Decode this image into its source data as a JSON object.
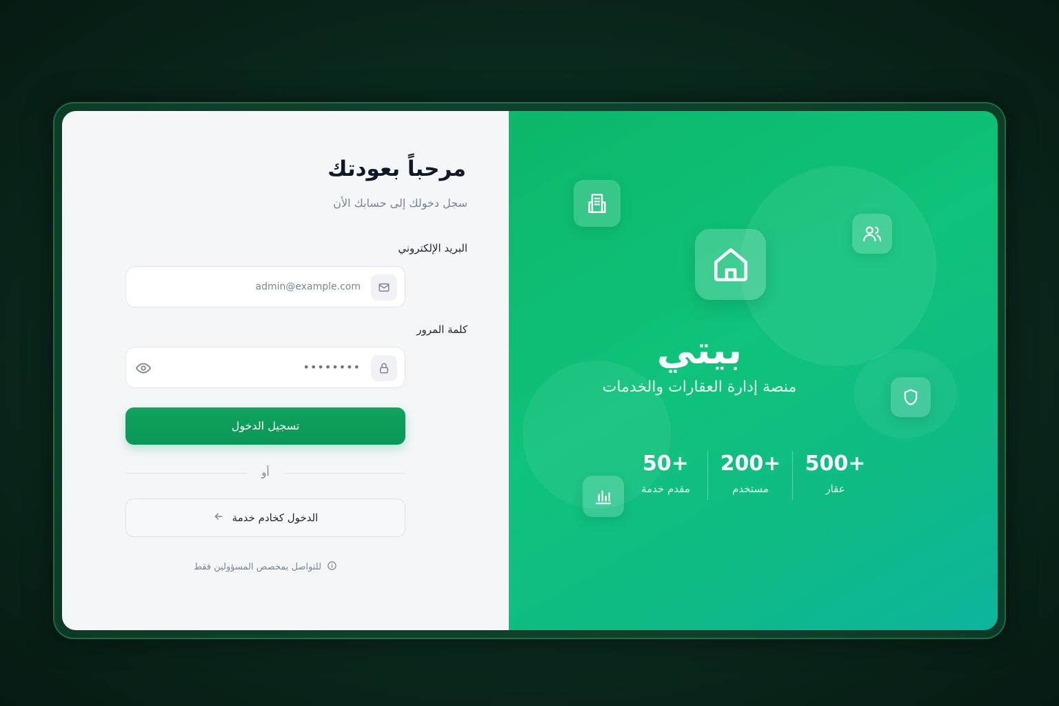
{
  "login": {
    "title": "مرحباً بعودتك",
    "subtitle": "سجل دخولك إلى حسابك الأن",
    "email_label": "البريد الإلكتروني",
    "email_value": "admin@example.com",
    "password_label": "كلمة المرور",
    "password_value": "••••••••",
    "submit_label": "تسجيل الدخول",
    "or_label": "أو",
    "provider_login_label": "الدخول كخادم خدمة",
    "note": "للتواصل بمخصص المسؤولين فقط"
  },
  "brand": {
    "name": "بيتي",
    "tagline": "منصة إدارة العقارات والخدمات"
  },
  "stats": [
    {
      "value": "500+",
      "label": "عقار"
    },
    {
      "value": "200+",
      "label": "مستخدم"
    },
    {
      "value": "50+",
      "label": "مقدم خدمة"
    }
  ],
  "colors": {
    "primary": "#0ea35e",
    "accent_gradient_start": "#0cb66a",
    "accent_gradient_end": "#0db59e"
  },
  "icons": {
    "building": "building-icon",
    "users": "users-icon",
    "home": "home-icon",
    "shield": "shield-icon",
    "chart": "bar-chart-icon",
    "mail": "mail-icon",
    "lock": "lock-icon",
    "eye": "eye-icon",
    "arrow": "arrow-left-icon",
    "info": "info-icon"
  }
}
